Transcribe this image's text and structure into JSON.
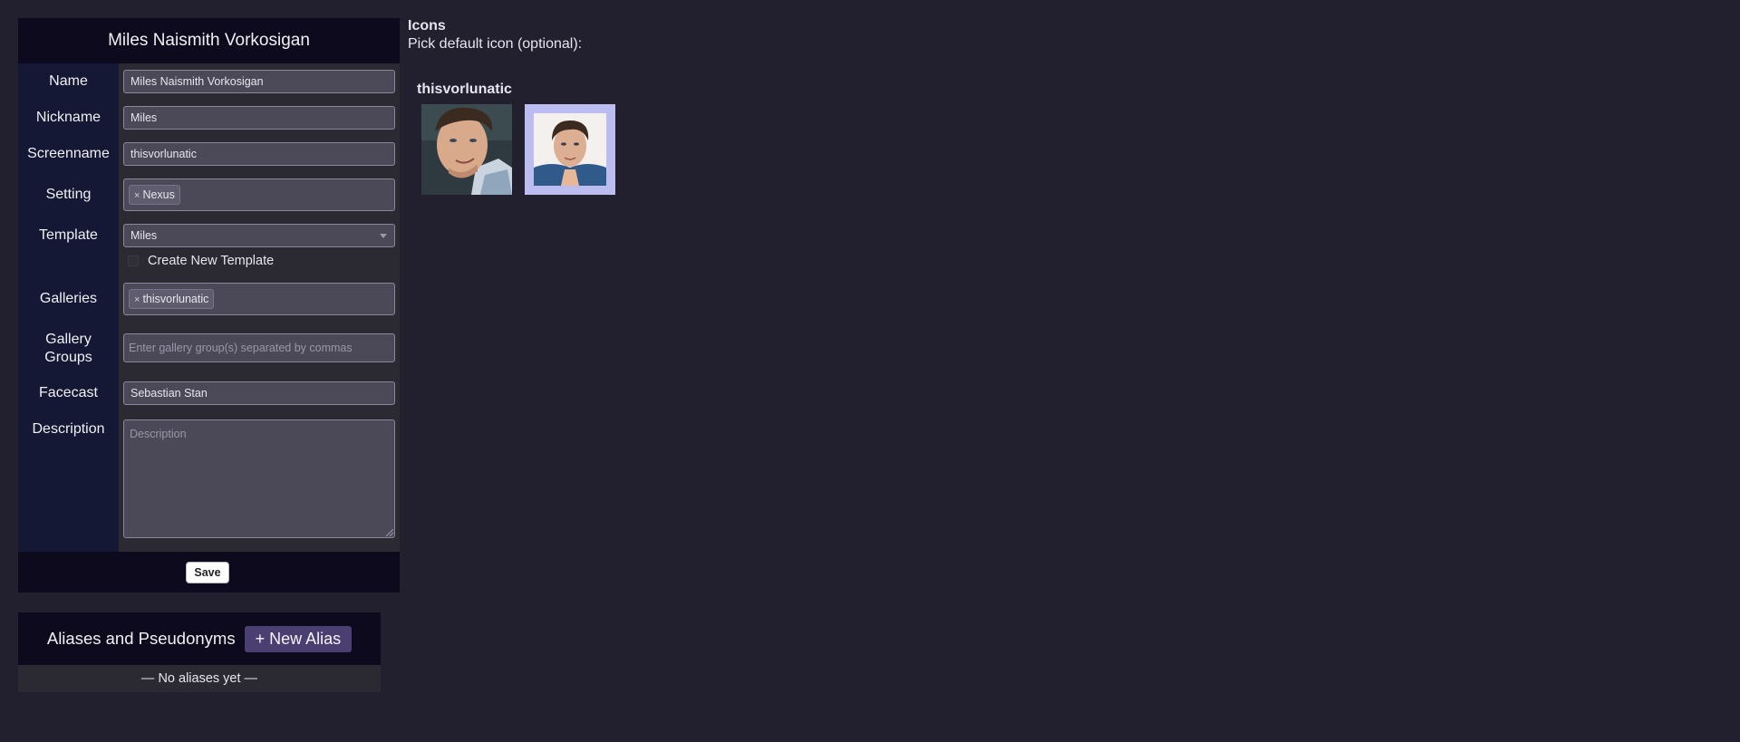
{
  "character": {
    "title": "Miles Naismith Vorkosigan",
    "fields": {
      "name": {
        "label": "Name",
        "value": "Miles Naismith Vorkosigan"
      },
      "nickname": {
        "label": "Nickname",
        "value": "Miles"
      },
      "screenname": {
        "label": "Screenname",
        "value": "thisvorlunatic"
      },
      "setting": {
        "label": "Setting",
        "tag": "Nexus",
        "remove_glyph": "×"
      },
      "template": {
        "label": "Template",
        "value": "Miles",
        "checkbox_label": "Create New Template"
      },
      "galleries": {
        "label": "Galleries",
        "tag": "thisvorlunatic",
        "remove_glyph": "×"
      },
      "gallery_groups": {
        "label": "Gallery Groups",
        "placeholder": "Enter gallery group(s) separated by commas"
      },
      "facecast": {
        "label": "Facecast",
        "value": "Sebastian Stan"
      },
      "description": {
        "label": "Description",
        "placeholder": "Description"
      }
    },
    "save_label": "Save"
  },
  "aliases": {
    "title": "Aliases and Pseudonyms",
    "new_button": "+ New Alias",
    "empty_text": "— No aliases yet —"
  },
  "icons": {
    "title": "Icons",
    "subtitle": "Pick default icon (optional):",
    "gallery_name": "thisvorlunatic",
    "selected_index": 1
  },
  "colors": {
    "background": "#221f2e",
    "header": "#0c0a1c",
    "label_column": "#141834",
    "field_column": "#2b2a33",
    "input": "#4b4858",
    "accent_button": "#4a3f70",
    "selected_icon_frame": "#bdbcf0"
  }
}
